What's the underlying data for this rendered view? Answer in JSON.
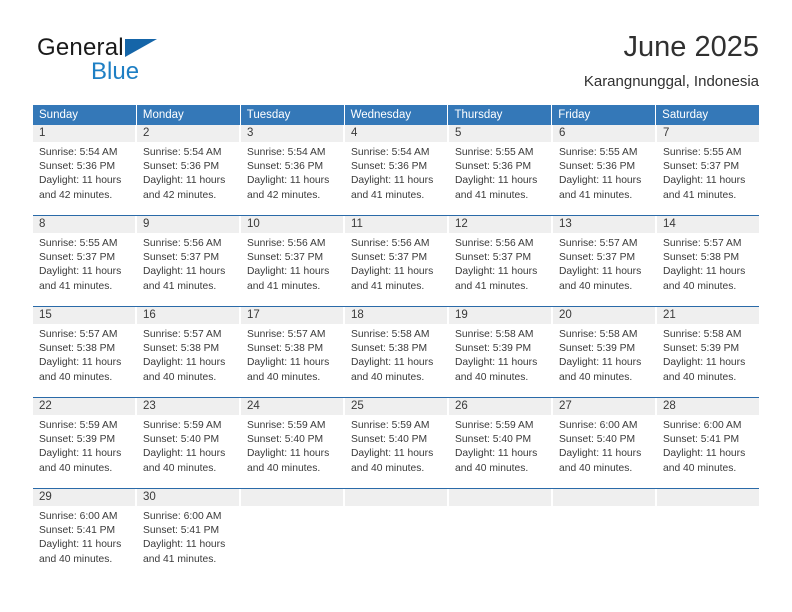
{
  "brand": {
    "name_part1": "General",
    "name_part2": "Blue",
    "triangle_icon": "triangle-icon",
    "color_dark": "#1a1a1a",
    "color_blue": "#1e7fc4"
  },
  "header": {
    "title": "June 2025",
    "subtitle": "Karangnunggal, Indonesia"
  },
  "theme": {
    "header_bg": "#3478b8",
    "day_number_bg": "#efefef",
    "row_divider": "#2a6aa8",
    "text": "#3a3a3a"
  },
  "weekdays": [
    "Sunday",
    "Monday",
    "Tuesday",
    "Wednesday",
    "Thursday",
    "Friday",
    "Saturday"
  ],
  "weeks": [
    [
      {
        "day": "1",
        "sunrise": "Sunrise: 5:54 AM",
        "sunset": "Sunset: 5:36 PM",
        "daylight1": "Daylight: 11 hours",
        "daylight2": "and 42 minutes."
      },
      {
        "day": "2",
        "sunrise": "Sunrise: 5:54 AM",
        "sunset": "Sunset: 5:36 PM",
        "daylight1": "Daylight: 11 hours",
        "daylight2": "and 42 minutes."
      },
      {
        "day": "3",
        "sunrise": "Sunrise: 5:54 AM",
        "sunset": "Sunset: 5:36 PM",
        "daylight1": "Daylight: 11 hours",
        "daylight2": "and 42 minutes."
      },
      {
        "day": "4",
        "sunrise": "Sunrise: 5:54 AM",
        "sunset": "Sunset: 5:36 PM",
        "daylight1": "Daylight: 11 hours",
        "daylight2": "and 41 minutes."
      },
      {
        "day": "5",
        "sunrise": "Sunrise: 5:55 AM",
        "sunset": "Sunset: 5:36 PM",
        "daylight1": "Daylight: 11 hours",
        "daylight2": "and 41 minutes."
      },
      {
        "day": "6",
        "sunrise": "Sunrise: 5:55 AM",
        "sunset": "Sunset: 5:36 PM",
        "daylight1": "Daylight: 11 hours",
        "daylight2": "and 41 minutes."
      },
      {
        "day": "7",
        "sunrise": "Sunrise: 5:55 AM",
        "sunset": "Sunset: 5:37 PM",
        "daylight1": "Daylight: 11 hours",
        "daylight2": "and 41 minutes."
      }
    ],
    [
      {
        "day": "8",
        "sunrise": "Sunrise: 5:55 AM",
        "sunset": "Sunset: 5:37 PM",
        "daylight1": "Daylight: 11 hours",
        "daylight2": "and 41 minutes."
      },
      {
        "day": "9",
        "sunrise": "Sunrise: 5:56 AM",
        "sunset": "Sunset: 5:37 PM",
        "daylight1": "Daylight: 11 hours",
        "daylight2": "and 41 minutes."
      },
      {
        "day": "10",
        "sunrise": "Sunrise: 5:56 AM",
        "sunset": "Sunset: 5:37 PM",
        "daylight1": "Daylight: 11 hours",
        "daylight2": "and 41 minutes."
      },
      {
        "day": "11",
        "sunrise": "Sunrise: 5:56 AM",
        "sunset": "Sunset: 5:37 PM",
        "daylight1": "Daylight: 11 hours",
        "daylight2": "and 41 minutes."
      },
      {
        "day": "12",
        "sunrise": "Sunrise: 5:56 AM",
        "sunset": "Sunset: 5:37 PM",
        "daylight1": "Daylight: 11 hours",
        "daylight2": "and 41 minutes."
      },
      {
        "day": "13",
        "sunrise": "Sunrise: 5:57 AM",
        "sunset": "Sunset: 5:37 PM",
        "daylight1": "Daylight: 11 hours",
        "daylight2": "and 40 minutes."
      },
      {
        "day": "14",
        "sunrise": "Sunrise: 5:57 AM",
        "sunset": "Sunset: 5:38 PM",
        "daylight1": "Daylight: 11 hours",
        "daylight2": "and 40 minutes."
      }
    ],
    [
      {
        "day": "15",
        "sunrise": "Sunrise: 5:57 AM",
        "sunset": "Sunset: 5:38 PM",
        "daylight1": "Daylight: 11 hours",
        "daylight2": "and 40 minutes."
      },
      {
        "day": "16",
        "sunrise": "Sunrise: 5:57 AM",
        "sunset": "Sunset: 5:38 PM",
        "daylight1": "Daylight: 11 hours",
        "daylight2": "and 40 minutes."
      },
      {
        "day": "17",
        "sunrise": "Sunrise: 5:57 AM",
        "sunset": "Sunset: 5:38 PM",
        "daylight1": "Daylight: 11 hours",
        "daylight2": "and 40 minutes."
      },
      {
        "day": "18",
        "sunrise": "Sunrise: 5:58 AM",
        "sunset": "Sunset: 5:38 PM",
        "daylight1": "Daylight: 11 hours",
        "daylight2": "and 40 minutes."
      },
      {
        "day": "19",
        "sunrise": "Sunrise: 5:58 AM",
        "sunset": "Sunset: 5:39 PM",
        "daylight1": "Daylight: 11 hours",
        "daylight2": "and 40 minutes."
      },
      {
        "day": "20",
        "sunrise": "Sunrise: 5:58 AM",
        "sunset": "Sunset: 5:39 PM",
        "daylight1": "Daylight: 11 hours",
        "daylight2": "and 40 minutes."
      },
      {
        "day": "21",
        "sunrise": "Sunrise: 5:58 AM",
        "sunset": "Sunset: 5:39 PM",
        "daylight1": "Daylight: 11 hours",
        "daylight2": "and 40 minutes."
      }
    ],
    [
      {
        "day": "22",
        "sunrise": "Sunrise: 5:59 AM",
        "sunset": "Sunset: 5:39 PM",
        "daylight1": "Daylight: 11 hours",
        "daylight2": "and 40 minutes."
      },
      {
        "day": "23",
        "sunrise": "Sunrise: 5:59 AM",
        "sunset": "Sunset: 5:40 PM",
        "daylight1": "Daylight: 11 hours",
        "daylight2": "and 40 minutes."
      },
      {
        "day": "24",
        "sunrise": "Sunrise: 5:59 AM",
        "sunset": "Sunset: 5:40 PM",
        "daylight1": "Daylight: 11 hours",
        "daylight2": "and 40 minutes."
      },
      {
        "day": "25",
        "sunrise": "Sunrise: 5:59 AM",
        "sunset": "Sunset: 5:40 PM",
        "daylight1": "Daylight: 11 hours",
        "daylight2": "and 40 minutes."
      },
      {
        "day": "26",
        "sunrise": "Sunrise: 5:59 AM",
        "sunset": "Sunset: 5:40 PM",
        "daylight1": "Daylight: 11 hours",
        "daylight2": "and 40 minutes."
      },
      {
        "day": "27",
        "sunrise": "Sunrise: 6:00 AM",
        "sunset": "Sunset: 5:40 PM",
        "daylight1": "Daylight: 11 hours",
        "daylight2": "and 40 minutes."
      },
      {
        "day": "28",
        "sunrise": "Sunrise: 6:00 AM",
        "sunset": "Sunset: 5:41 PM",
        "daylight1": "Daylight: 11 hours",
        "daylight2": "and 40 minutes."
      }
    ],
    [
      {
        "day": "29",
        "sunrise": "Sunrise: 6:00 AM",
        "sunset": "Sunset: 5:41 PM",
        "daylight1": "Daylight: 11 hours",
        "daylight2": "and 40 minutes."
      },
      {
        "day": "30",
        "sunrise": "Sunrise: 6:00 AM",
        "sunset": "Sunset: 5:41 PM",
        "daylight1": "Daylight: 11 hours",
        "daylight2": "and 41 minutes."
      },
      {
        "day": "",
        "sunrise": "",
        "sunset": "",
        "daylight1": "",
        "daylight2": ""
      },
      {
        "day": "",
        "sunrise": "",
        "sunset": "",
        "daylight1": "",
        "daylight2": ""
      },
      {
        "day": "",
        "sunrise": "",
        "sunset": "",
        "daylight1": "",
        "daylight2": ""
      },
      {
        "day": "",
        "sunrise": "",
        "sunset": "",
        "daylight1": "",
        "daylight2": ""
      },
      {
        "day": "",
        "sunrise": "",
        "sunset": "",
        "daylight1": "",
        "daylight2": ""
      }
    ]
  ]
}
